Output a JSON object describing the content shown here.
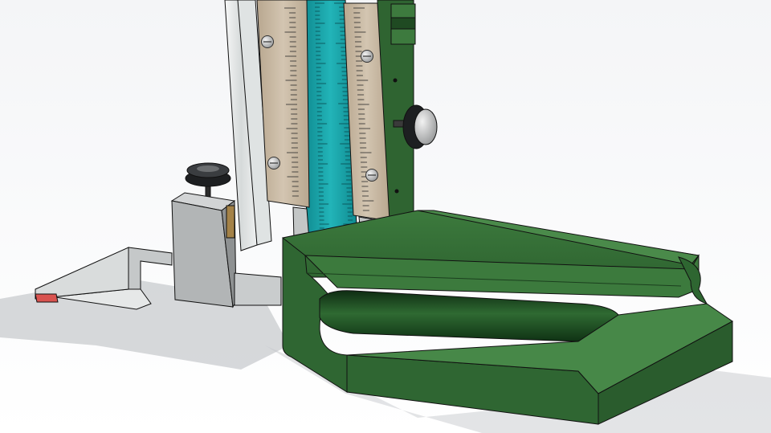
{
  "viewport": {
    "label": "",
    "background_top": "#f6f7f9",
    "background_bottom": "#ffffff"
  },
  "colors": {
    "base_green": "#3f7a3f",
    "base_green_dark": "#1f4a22",
    "base_green_light": "#5d9a5a",
    "column_green": "#356b37",
    "scale_teal": "#18a3a8",
    "scale_teal_dark": "#0d7d84",
    "vernier_tan": "#c9b9a4",
    "vernier_tan_dark": "#a8977f",
    "rail_light": "#e9ecec",
    "slide_gray": "#b9bcbd",
    "scriber_tip": "#d9534f",
    "knob_black": "#1d1f21",
    "outline": "#111111"
  },
  "parts": [
    "granite-base",
    "column",
    "main-scale",
    "vernier-plate-left",
    "vernier-plate-right",
    "slider-carriage",
    "fine-adjust-knob",
    "lock-knob",
    "scriber-block",
    "scriber-arm",
    "scriber-tip",
    "guide-rail"
  ]
}
